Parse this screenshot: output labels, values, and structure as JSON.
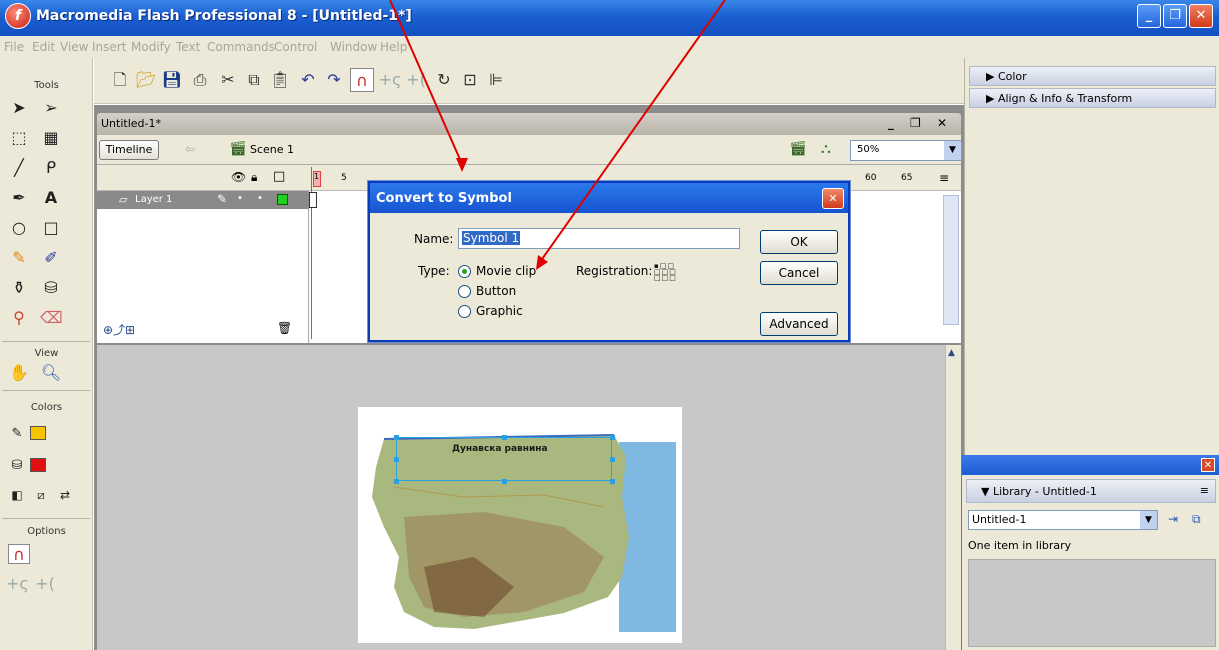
{
  "window": {
    "title": "Macromedia Flash Professional 8 - [Untitled-1*]",
    "logo": "f",
    "controls": {
      "minimize": "_",
      "restore": "❐",
      "close": "✕"
    }
  },
  "menu": [
    "File",
    "Edit",
    "View",
    "Insert",
    "Modify",
    "Text",
    "Commands",
    "Control",
    "Window",
    "Help"
  ],
  "tools_panel": {
    "title": "Tools",
    "view_label": "View",
    "colors_label": "Colors",
    "options_label": "Options",
    "stroke_color": "#f5c400",
    "fill_color": "#e01010"
  },
  "document": {
    "tab_label": "Untitled-1*",
    "tab_controls": "_ ❐ ✕",
    "timeline_button": "Timeline",
    "scene_label": "Scene 1",
    "zoom": "50%",
    "layer_name": "Layer 1",
    "frame_numbers": [
      "1",
      "5",
      "60",
      "65"
    ]
  },
  "stage": {
    "map_label": "Дунавска равнина"
  },
  "dialog": {
    "title": "Convert to Symbol",
    "name_label": "Name:",
    "name_value": "Symbol 1",
    "type_label": "Type:",
    "types": [
      "Movie clip",
      "Button",
      "Graphic"
    ],
    "selected_type": "Movie clip",
    "registration_label": "Registration:",
    "ok": "OK",
    "cancel": "Cancel",
    "advanced": "Advanced"
  },
  "right_panels": {
    "color": "Color",
    "align": "Align & Info & Transform"
  },
  "library": {
    "title": "Library - Untitled-1",
    "selected_doc": "Untitled-1",
    "count_text": "One item in library"
  },
  "colors": {
    "titlebar": "#1a5fd0",
    "annotation_arrow": "#e00000"
  }
}
